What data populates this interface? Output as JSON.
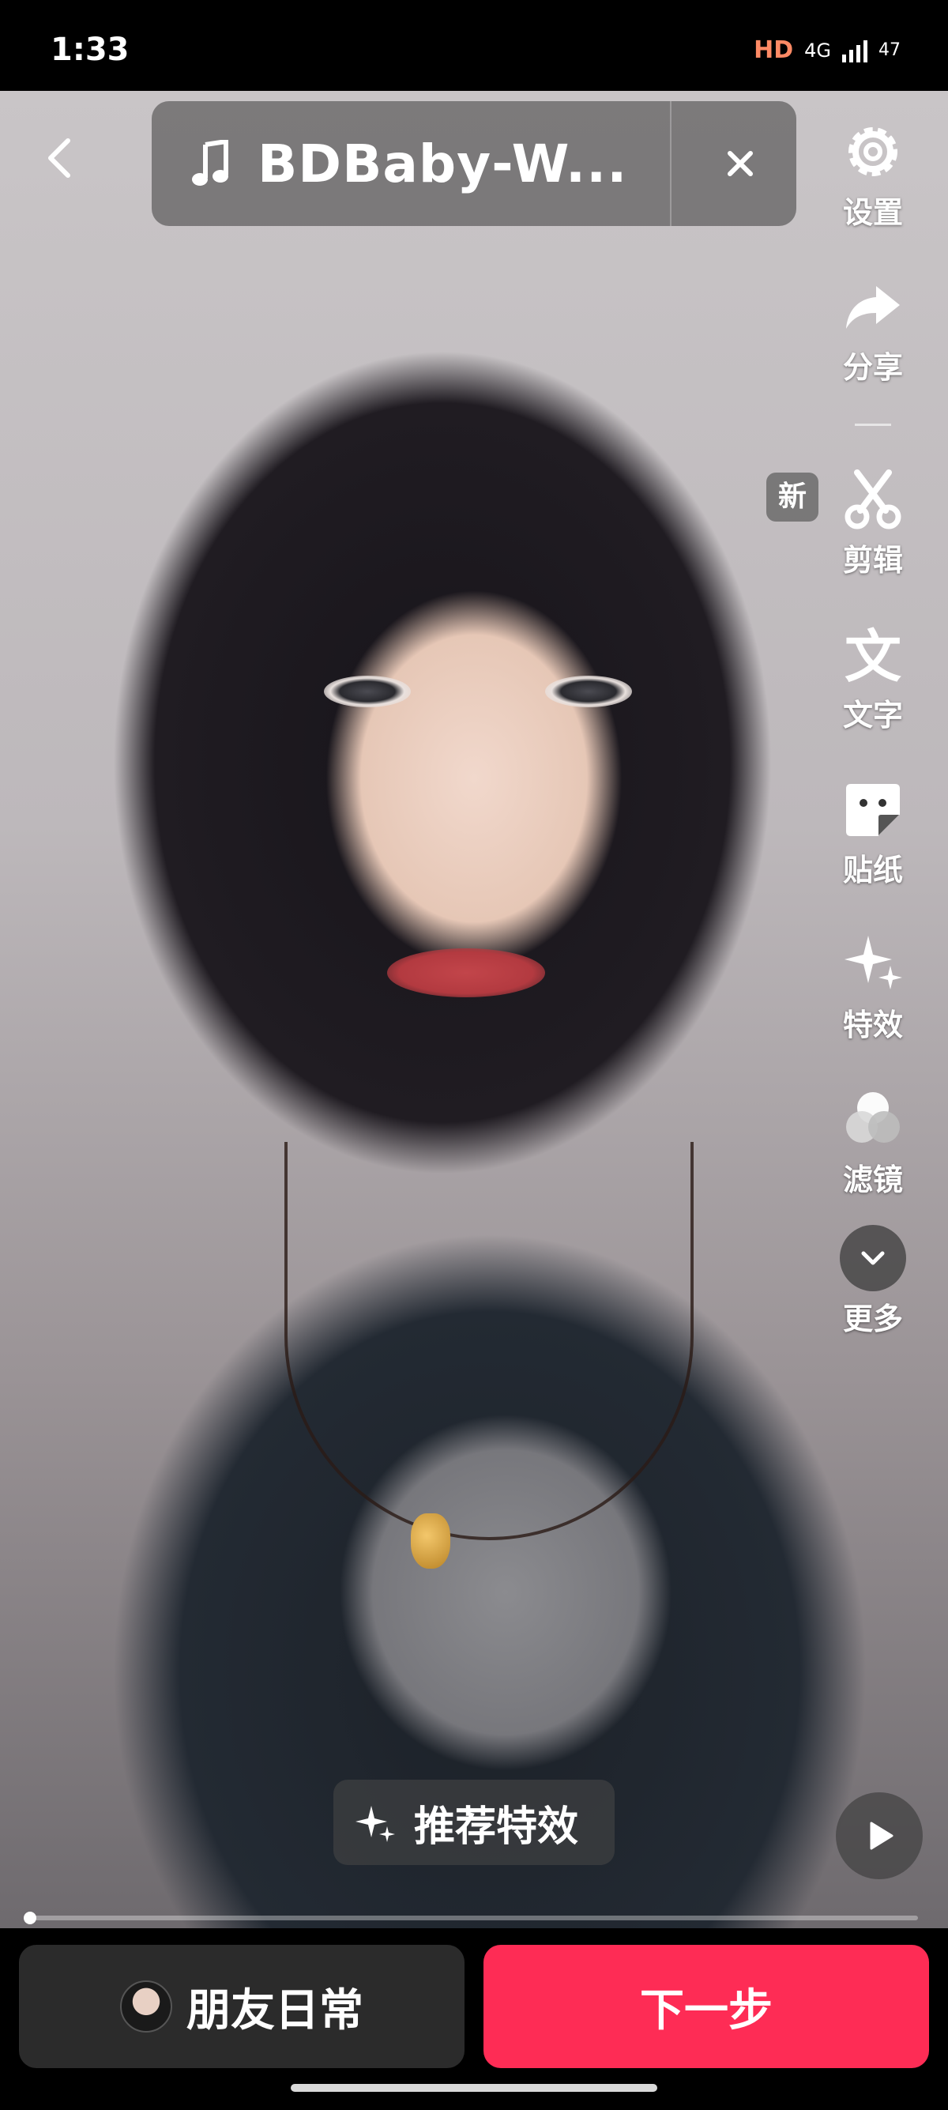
{
  "status_bar": {
    "time": "1:33",
    "hd_label": "HD",
    "network": "4G",
    "battery": "47"
  },
  "music": {
    "title": "BDBaby-W...",
    "note_icon": "music-note-icon",
    "close_icon": "close-icon"
  },
  "rail": {
    "settings": "设置",
    "share": "分享",
    "new_badge": "新",
    "edit": "剪辑",
    "text": "文字",
    "sticker": "贴纸",
    "effects": "特效",
    "filter": "滤镜",
    "more": "更多"
  },
  "recommended": {
    "label": "推荐特效"
  },
  "progress": {
    "fraction": 0.0
  },
  "bottom": {
    "friends_label": "朋友日常",
    "next_label": "下一步"
  },
  "colors": {
    "accent": "#fe2c55",
    "dark_button": "#2b2b2b"
  }
}
